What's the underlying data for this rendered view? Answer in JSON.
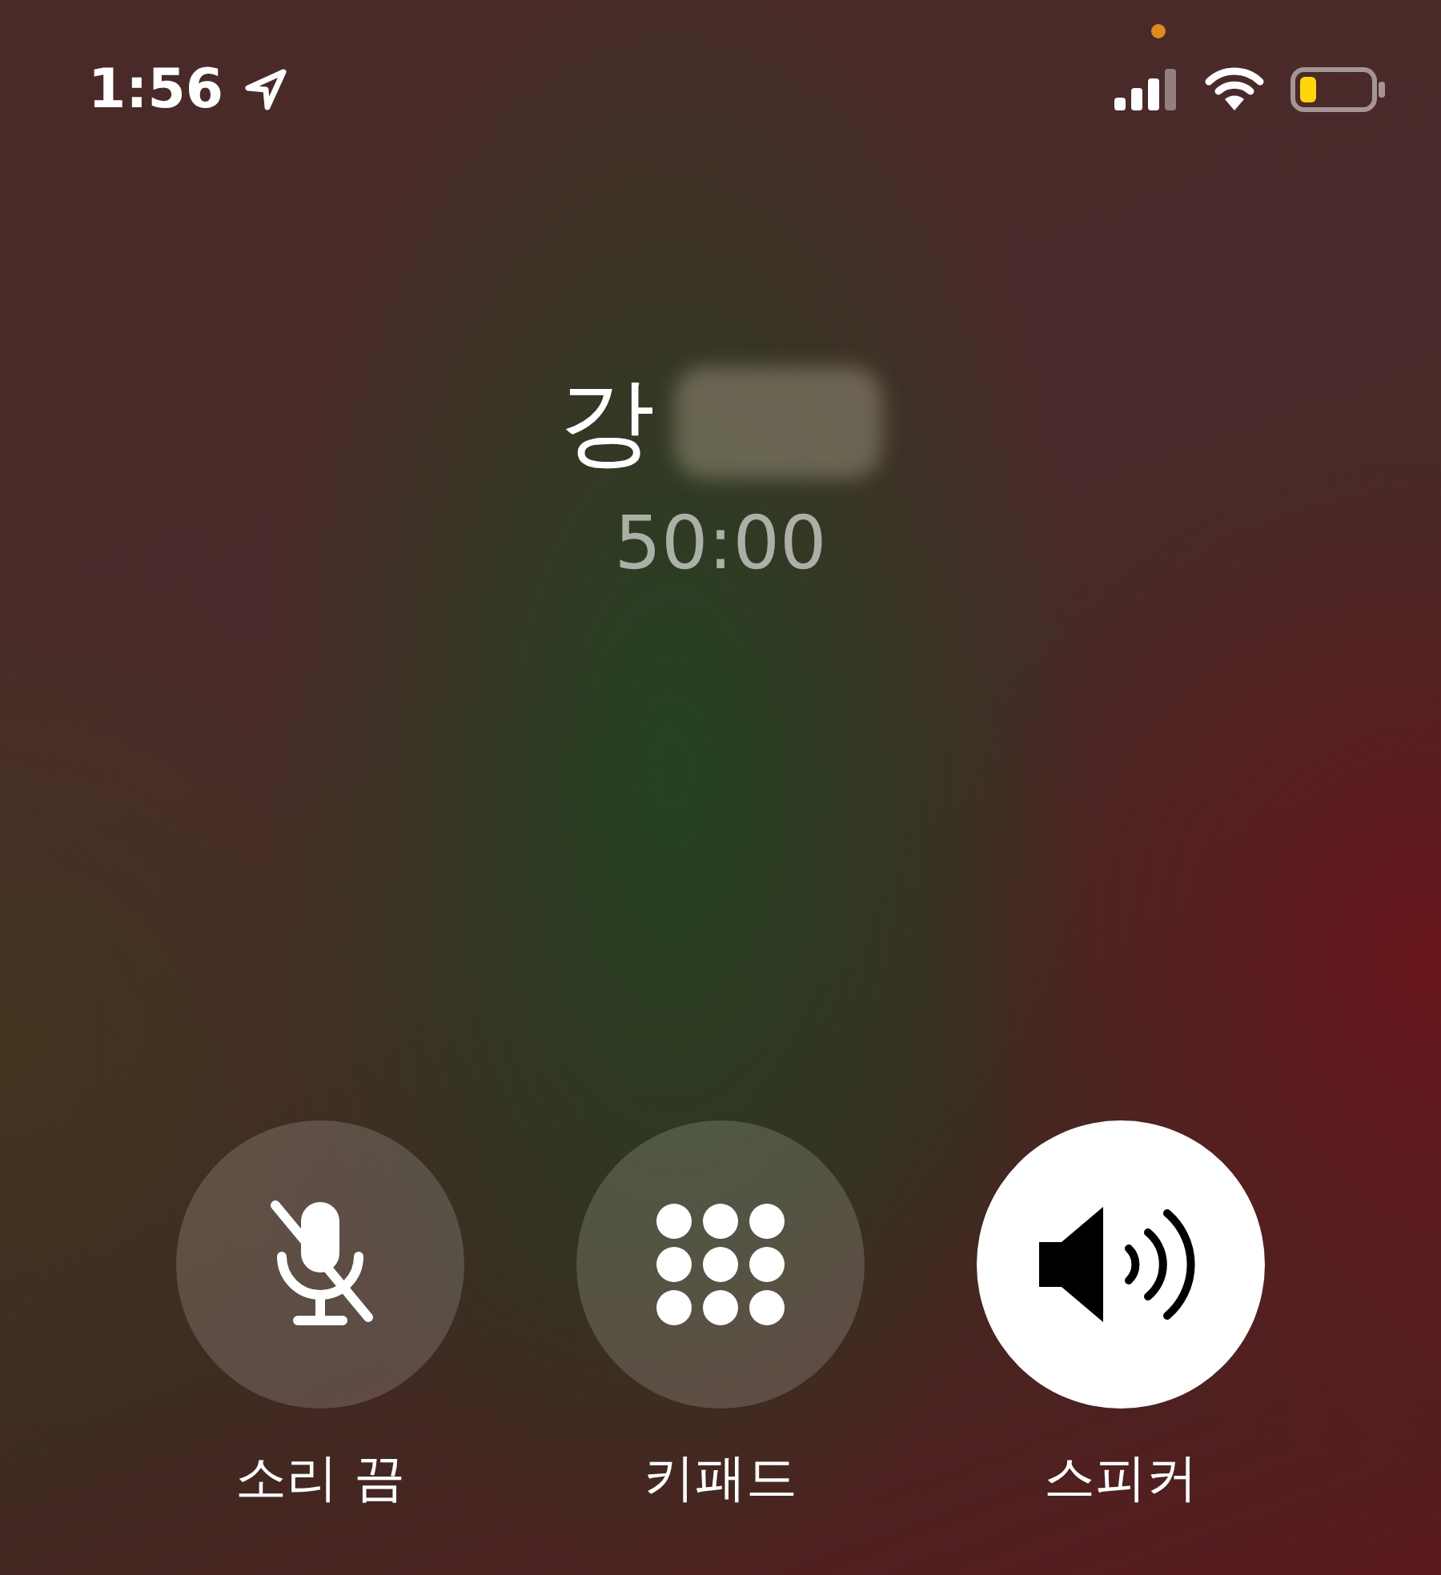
{
  "status_bar": {
    "time": "1:56"
  },
  "call": {
    "name": "강",
    "duration": "50:00"
  },
  "controls": [
    {
      "kind": "mute",
      "label": "소리 끔",
      "selected": false
    },
    {
      "kind": "keypad",
      "label": "키패드",
      "selected": false
    },
    {
      "kind": "speaker",
      "label": "스피커",
      "selected": true
    }
  ]
}
